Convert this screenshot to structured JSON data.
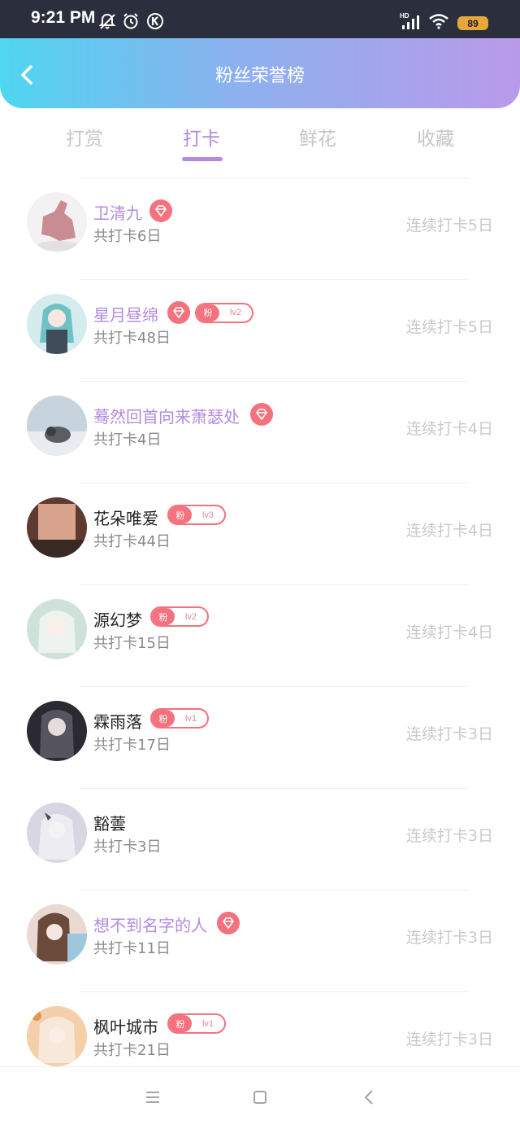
{
  "status_bar": {
    "time": "9:21 PM",
    "battery": "89",
    "network": "HD",
    "icons": [
      "bell-off-icon",
      "alarm-icon",
      "k-circle-icon",
      "signal-icon",
      "wifi-icon",
      "battery-icon"
    ]
  },
  "header": {
    "title": "粉丝荣誉榜",
    "back_icon": "chevron-left-icon"
  },
  "tabs": [
    {
      "label": "打赏",
      "active": false
    },
    {
      "label": "打卡",
      "active": true
    },
    {
      "label": "鲜花",
      "active": false
    },
    {
      "label": "收藏",
      "active": false
    }
  ],
  "fan_badge_label": "粉",
  "rows": [
    {
      "name": "卫清九",
      "total": "共打卡6日",
      "streak": "连续打卡5日",
      "vip": true,
      "fan_level": ""
    },
    {
      "name": "星月昼绵",
      "total": "共打卡48日",
      "streak": "连续打卡5日",
      "vip": true,
      "fan_level": "lv2"
    },
    {
      "name": "蓦然回首向来萧瑟处",
      "total": "共打卡4日",
      "streak": "连续打卡4日",
      "vip": true,
      "fan_level": ""
    },
    {
      "name": "花朵唯爱",
      "total": "共打卡44日",
      "streak": "连续打卡4日",
      "vip": false,
      "fan_level": "lv3"
    },
    {
      "name": "源幻梦",
      "total": "共打卡15日",
      "streak": "连续打卡4日",
      "vip": false,
      "fan_level": "lv2"
    },
    {
      "name": "霖雨落",
      "total": "共打卡17日",
      "streak": "连续打卡3日",
      "vip": false,
      "fan_level": "lv1"
    },
    {
      "name": "豁蕓",
      "total": "共打卡3日",
      "streak": "连续打卡3日",
      "vip": false,
      "fan_level": ""
    },
    {
      "name": "想不到名字的人",
      "total": "共打卡11日",
      "streak": "连续打卡3日",
      "vip": true,
      "fan_level": ""
    },
    {
      "name": "枫叶城市",
      "total": "共打卡21日",
      "streak": "连续打卡3日",
      "vip": false,
      "fan_level": "lv1"
    }
  ],
  "nav": {
    "icons": [
      "menu-icon",
      "home-square-icon",
      "back-triangle-icon"
    ]
  },
  "colors": {
    "accent": "#b48ae0",
    "badge": "#f3727d",
    "header_start": "#4fd6f1",
    "header_end": "#b99aea"
  }
}
